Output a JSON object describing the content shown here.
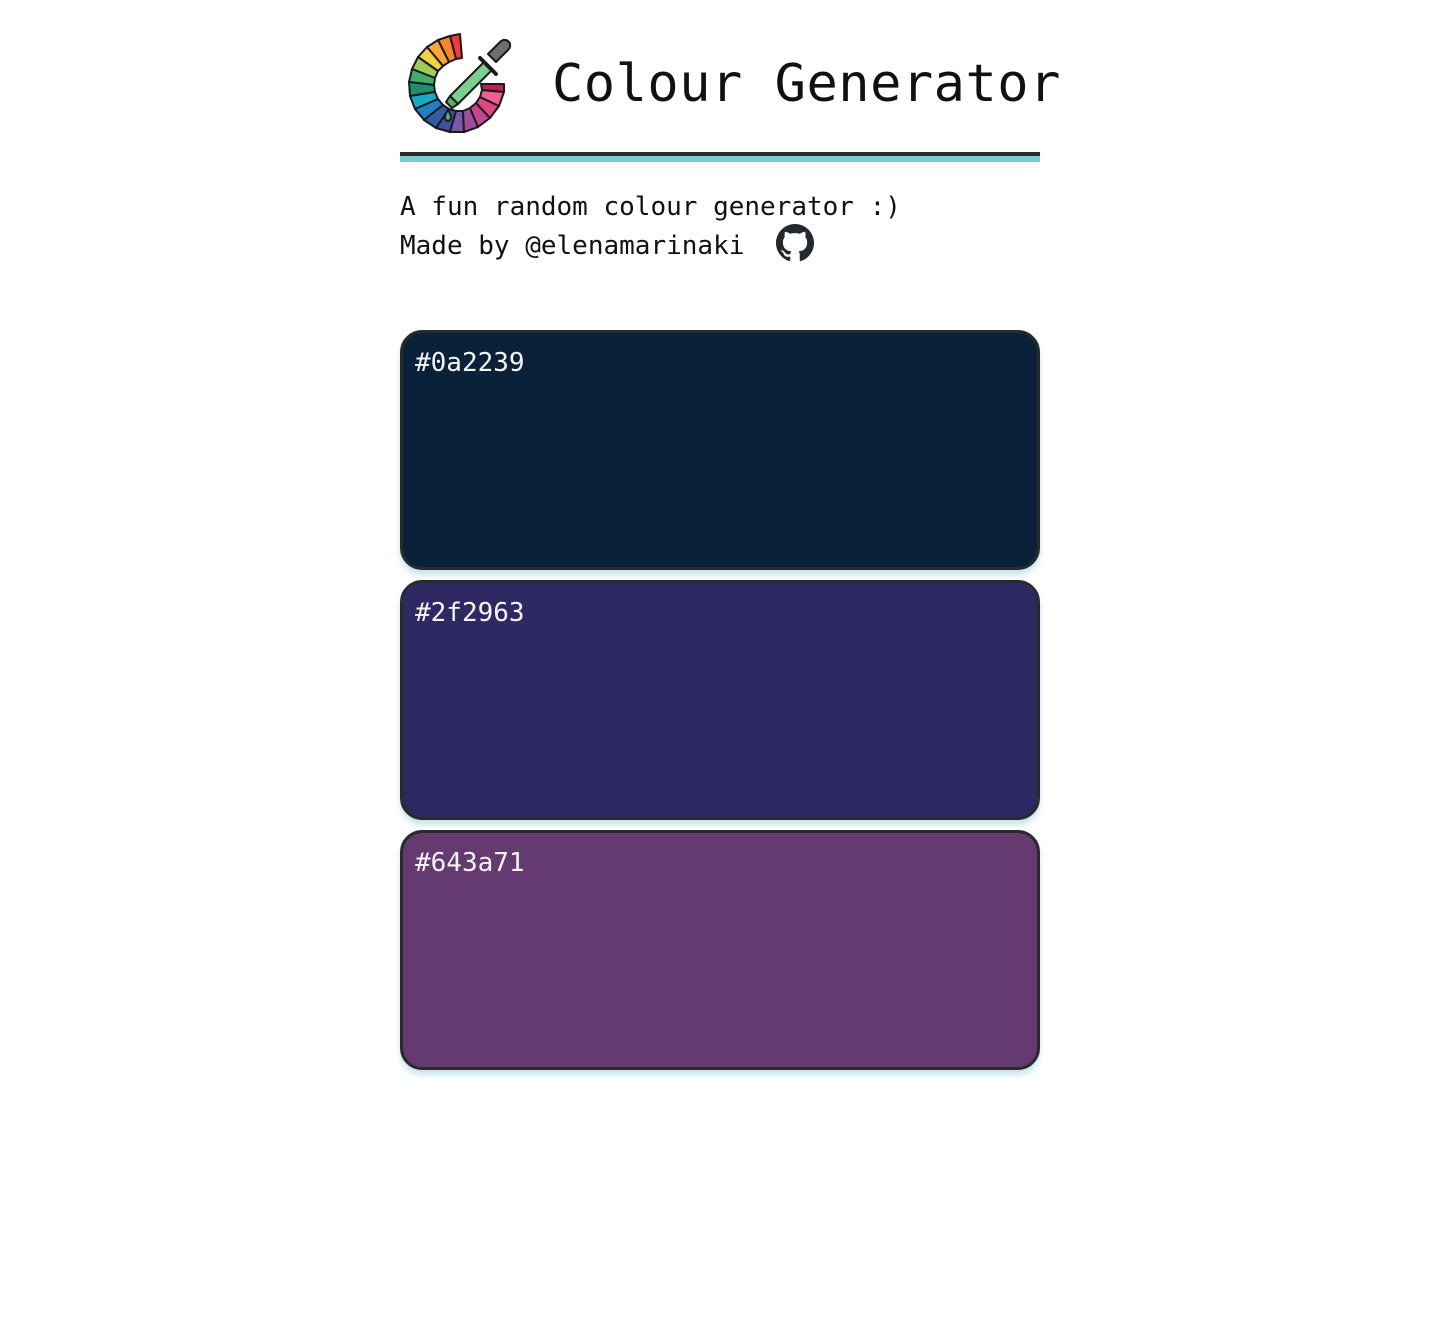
{
  "header": {
    "title": "Colour Generator",
    "logo_icon": "colour-wheel-dropper-icon"
  },
  "intro": {
    "tagline": "A fun random colour generator :)",
    "credit": "Made by @elenamarinaki",
    "github_icon": "github-icon"
  },
  "theme": {
    "rule_dark": "#2c2c2c",
    "rule_accent": "#7fc8d2",
    "swatch_border": "#2a2a2a"
  },
  "swatches": [
    {
      "hex": "#0a2239"
    },
    {
      "hex": "#2f2963"
    },
    {
      "hex": "#643a71"
    }
  ]
}
